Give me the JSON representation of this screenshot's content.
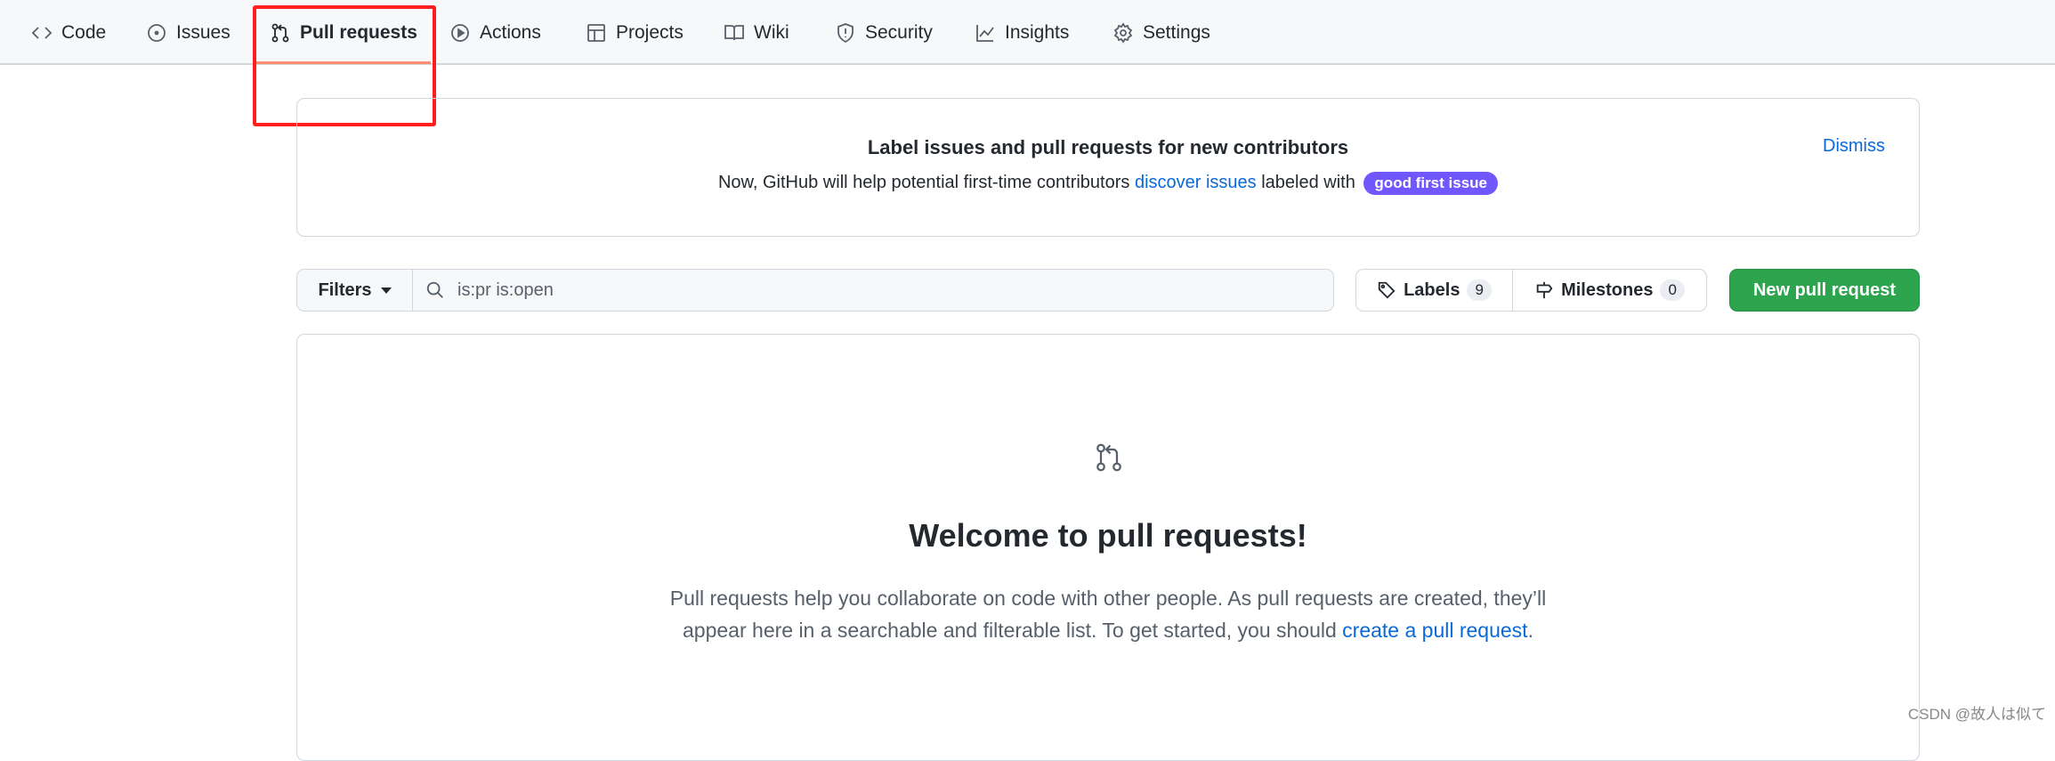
{
  "nav": {
    "tabs": [
      {
        "label": "Code",
        "icon": "code-icon"
      },
      {
        "label": "Issues",
        "icon": "issue-icon"
      },
      {
        "label": "Pull requests",
        "icon": "pull-request-icon",
        "active": true
      },
      {
        "label": "Actions",
        "icon": "play-icon"
      },
      {
        "label": "Projects",
        "icon": "table-icon"
      },
      {
        "label": "Wiki",
        "icon": "book-icon"
      },
      {
        "label": "Security",
        "icon": "shield-icon"
      },
      {
        "label": "Insights",
        "icon": "graph-icon"
      },
      {
        "label": "Settings",
        "icon": "gear-icon"
      }
    ],
    "active_underline_color": "#fd8c73",
    "highlight_box_color": "#ff1f1f"
  },
  "banner": {
    "title": "Label issues and pull requests for new contributors",
    "text_before": "Now, GitHub will help potential first-time contributors ",
    "link": "discover issues",
    "text_after": " labeled with ",
    "label": "good first issue",
    "label_color": "#7057ff",
    "dismiss": "Dismiss"
  },
  "toolbar": {
    "filters": "Filters",
    "search_value": "is:pr is:open",
    "labels": "Labels",
    "labels_count": "9",
    "milestones": "Milestones",
    "milestones_count": "0",
    "new_pr": "New pull request",
    "new_pr_color": "#2da44e"
  },
  "blankslate": {
    "title": "Welcome to pull requests!",
    "text": "Pull requests help you collaborate on code with other people. As pull requests are created, they’ll appear here in a searchable and filterable list. To get started, you should ",
    "link": "create a pull request",
    "end": "."
  },
  "watermark": "CSDN @故人は似て"
}
